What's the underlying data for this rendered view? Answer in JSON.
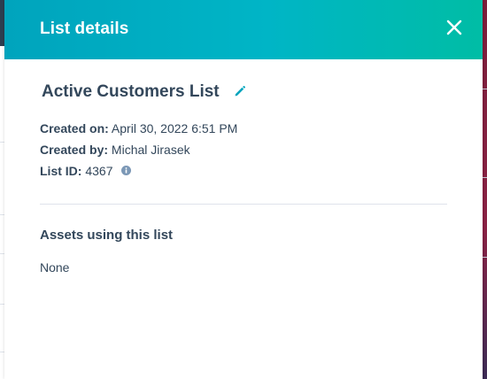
{
  "panel": {
    "title": "List details",
    "close_icon": "close-icon"
  },
  "list": {
    "name": "Active Customers List",
    "edit_icon": "pencil-icon"
  },
  "details": {
    "created_on_label": "Created on:",
    "created_on_value": "April 30, 2022 6:51 PM",
    "created_by_label": "Created by:",
    "created_by_value": "Michal Jirasek",
    "list_id_label": "List ID:",
    "list_id_value": "4367",
    "info_icon": "info-icon"
  },
  "assets": {
    "title": "Assets using this list",
    "value": "None"
  },
  "colors": {
    "header_gradient_start": "#00a4bd",
    "header_gradient_end": "#00bda5",
    "text": "#33475b",
    "accent": "#00a4bd",
    "divider": "#dfe3eb"
  }
}
